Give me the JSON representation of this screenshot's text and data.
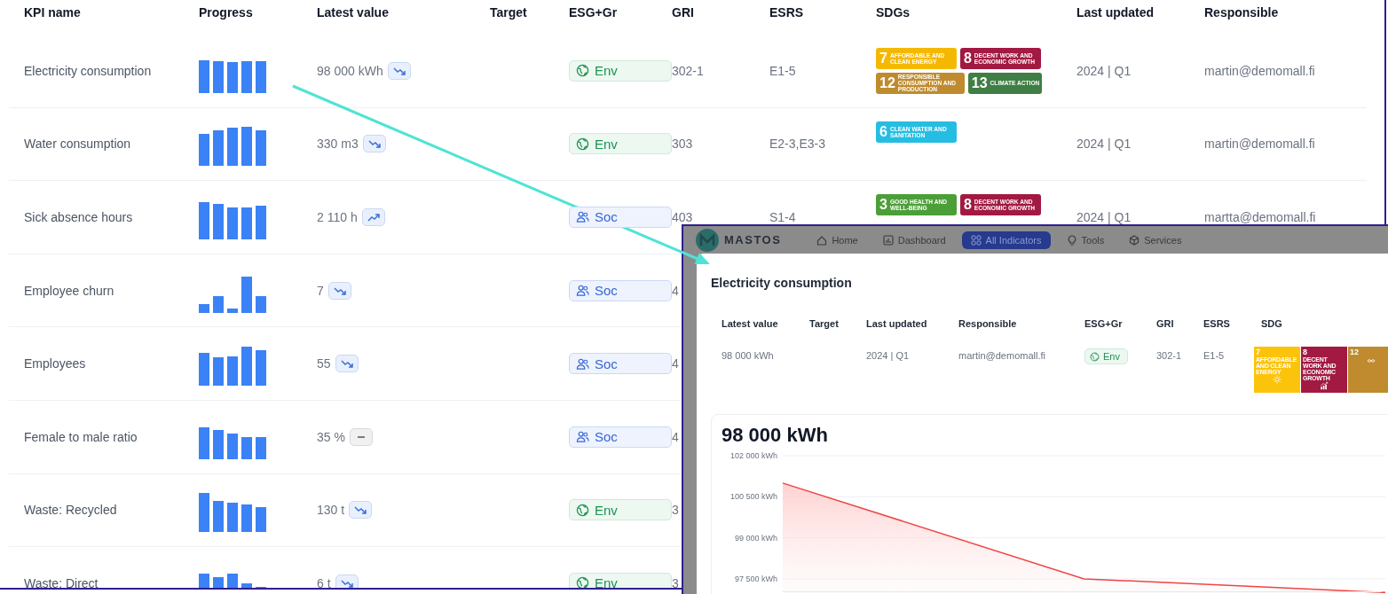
{
  "table": {
    "columns": [
      "KPI name",
      "Progress",
      "Latest value",
      "Target",
      "ESG+Gr",
      "GRI",
      "ESRS",
      "SDGs",
      "Last updated",
      "Responsible"
    ],
    "rows": [
      {
        "kpi_name": "Electricity consumption",
        "latest_value": "98 000 kWh",
        "trend": {
          "kind": "down"
        },
        "esg": {
          "kind": "env",
          "label": "Env"
        },
        "gri": "302-1",
        "esrs": "E1-5",
        "sdgs": [
          {
            "number": "7",
            "label": "AFFORDABLE AND CLEAN ENERGY",
            "color": "#f5b800"
          },
          {
            "number": "8",
            "label": "DECENT WORK AND ECONOMIC GROWTH",
            "color": "#a21942"
          },
          {
            "number": "12",
            "label": "RESPONSIBLE CONSUMPTION AND PRODUCTION",
            "color": "#bf8b2e"
          },
          {
            "number": "13",
            "label": "CLIMATE ACTION",
            "color": "#3f7e44"
          }
        ],
        "last_updated": "2024 | Q1",
        "responsible": "martin@demomall.fi"
      },
      {
        "kpi_name": "Water consumption",
        "latest_value": "330 m3",
        "trend": {
          "kind": "down"
        },
        "esg": {
          "kind": "env",
          "label": "Env"
        },
        "gri": "303",
        "esrs": "E2-3,E3-3",
        "sdgs": [
          {
            "number": "6",
            "label": "CLEAN WATER AND SANITATION",
            "color": "#26bde2"
          }
        ],
        "last_updated": "2024 | Q1",
        "responsible": "martin@demomall.fi"
      },
      {
        "kpi_name": "Sick absence hours",
        "latest_value": "2 110 h",
        "trend": {
          "kind": "up"
        },
        "esg": {
          "kind": "soc",
          "label": "Soc"
        },
        "gri": "403",
        "esrs": "S1-4",
        "sdgs": [
          {
            "number": "3",
            "label": "GOOD HEALTH AND WELL-BEING",
            "color": "#4c9f38"
          },
          {
            "number": "8",
            "label": "DECENT WORK AND ECONOMIC GROWTH",
            "color": "#a21942"
          }
        ],
        "last_updated": "2024 | Q1",
        "responsible": "martta@demomall.fi"
      },
      {
        "kpi_name": "Employee churn",
        "latest_value": "7",
        "trend": {
          "kind": "down"
        },
        "esg": {
          "kind": "soc",
          "label": "Soc"
        },
        "gri": "4"
      },
      {
        "kpi_name": "Employees",
        "latest_value": "55",
        "trend": {
          "kind": "down"
        },
        "esg": {
          "kind": "soc",
          "label": "Soc"
        },
        "gri": "4"
      },
      {
        "kpi_name": "Female to male ratio",
        "latest_value": "35 %",
        "trend": {
          "kind": "flat"
        },
        "esg": {
          "kind": "soc",
          "label": "Soc"
        },
        "gri": "4"
      },
      {
        "kpi_name": "Waste: Recycled",
        "latest_value": "130 t",
        "trend": {
          "kind": "down"
        },
        "esg": {
          "kind": "env",
          "label": "Env"
        },
        "gri": "3"
      },
      {
        "kpi_name": "Waste: Direct",
        "latest_value": "6 t",
        "trend": {
          "kind": "down"
        },
        "esg": {
          "kind": "env",
          "label": "Env"
        },
        "gri": "3"
      }
    ]
  },
  "detail_window": {
    "nav": {
      "logo": "MASTOS",
      "items": [
        {
          "label": "Home",
          "kind": "home",
          "selected": false
        },
        {
          "label": "Dashboard",
          "kind": "dashboard",
          "selected": false
        },
        {
          "label": "All Indicators",
          "kind": "grid",
          "selected": true
        },
        {
          "label": "Tools",
          "kind": "bulb",
          "selected": false
        },
        {
          "label": "Services",
          "kind": "cube",
          "selected": false
        }
      ]
    },
    "dialog": {
      "title": "Electricity consumption",
      "columns": [
        "Latest value",
        "Target",
        "Last updated",
        "Responsible",
        "ESG+Gr",
        "GRI",
        "ESRS",
        "SDG"
      ],
      "values": {
        "latest_value": "98 000 kWh",
        "last_updated": "2024 | Q1",
        "responsible": "martin@demomall.fi",
        "esg": {
          "kind": "env",
          "label": "Env"
        },
        "gri": "302-1",
        "esrs": "E1-5",
        "sdgs": [
          {
            "number": "7",
            "label": "AFFORDABLE AND CLEAN ENERGY",
            "color": "#fcc30b"
          },
          {
            "number": "8",
            "label": "DECENT WORK AND ECONOMIC GROWTH",
            "color": "#a21942"
          },
          {
            "number": "12",
            "color": "#bf8b2e"
          }
        ]
      },
      "chart_card": {
        "headline": "98 000 kWh",
        "chart_data": {
          "type": "area",
          "grid": true,
          "ylim": [
            97000,
            102000
          ],
          "yticks": [
            {
              "value": 102000,
              "label": "102 000 kWh"
            },
            {
              "value": 100500,
              "label": "100 500 kWh"
            },
            {
              "value": 99000,
              "label": "99 000 kWh"
            },
            {
              "value": 97500,
              "label": "97 500 kWh"
            }
          ],
          "series": [
            {
              "color": "#ef4444",
              "values": [
                101000,
                97500,
                97000
              ]
            }
          ]
        }
      }
    }
  }
}
